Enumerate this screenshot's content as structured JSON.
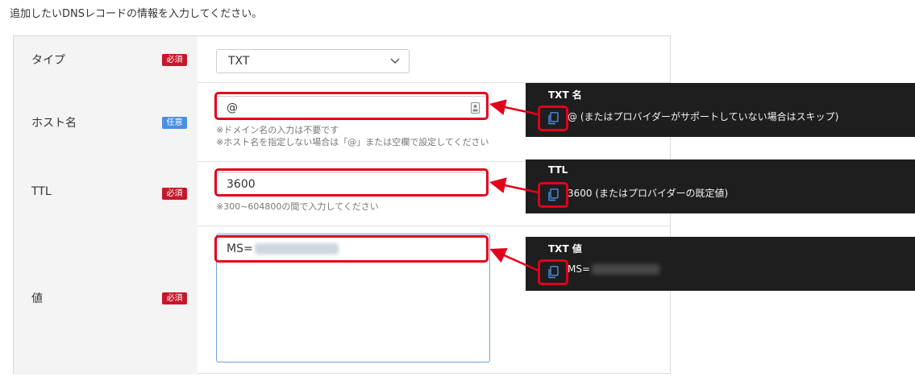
{
  "intro": "追加したいDNSレコードの情報を入力してください。",
  "badges": {
    "required": "必須",
    "optional": "任意"
  },
  "fields": {
    "type": {
      "label": "タイプ",
      "value": "TXT"
    },
    "host": {
      "label": "ホスト名",
      "value": "@",
      "note1": "※ドメイン名の入力は不要です",
      "note2": "※ホスト名を指定しない場合は「@」または空欄で設定してください"
    },
    "ttl": {
      "label": "TTL",
      "value": "3600",
      "note": "※300~604800の間で入力してください"
    },
    "value": {
      "label": "値",
      "value_prefix": "MS="
    }
  },
  "tips": [
    {
      "title": "TXT 名",
      "value": "@ (またはプロバイダーがサポートしていない場合はスキップ)"
    },
    {
      "title": "TTL",
      "value": "3600 (またはプロバイダーの既定値)"
    },
    {
      "title": "TXT 値",
      "value": "MS="
    }
  ],
  "colors": {
    "highlight": "#e3001b",
    "required_badge": "#c9162b",
    "optional_badge": "#4a90e2",
    "tip_bg": "#1e1e1e"
  },
  "icons": {
    "copy": "copy-icon",
    "select": "chevron-down-icon",
    "host_field": "contact-card-icon"
  }
}
